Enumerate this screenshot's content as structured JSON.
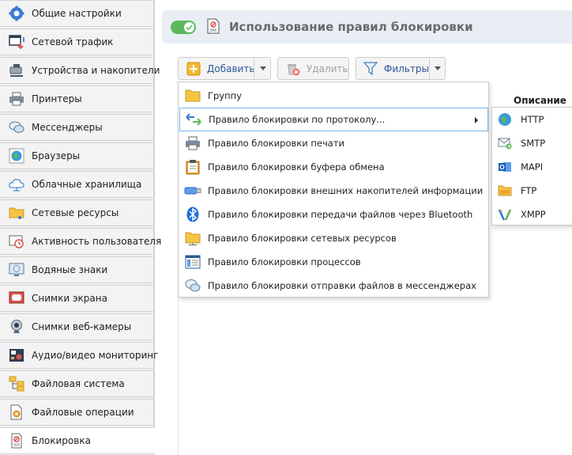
{
  "sidebar": {
    "items": [
      {
        "label": "Общие настройки",
        "icon": "gear-icon"
      },
      {
        "label": "Сетевой трафик",
        "icon": "network-traffic-icon"
      },
      {
        "label": "Устройства и накопители",
        "icon": "usb-device-icon"
      },
      {
        "label": "Принтеры",
        "icon": "printer-icon"
      },
      {
        "label": "Мессенджеры",
        "icon": "chat-icon"
      },
      {
        "label": "Браузеры",
        "icon": "browser-globe-icon"
      },
      {
        "label": "Облачные хранилища",
        "icon": "cloud-icon"
      },
      {
        "label": "Сетевые ресурсы",
        "icon": "network-folder-icon"
      },
      {
        "label": "Активность пользователя",
        "icon": "activity-clock-icon"
      },
      {
        "label": "Водяные знаки",
        "icon": "watermark-monitor-icon"
      },
      {
        "label": "Снимки экрана",
        "icon": "screenshot-icon"
      },
      {
        "label": "Снимки веб-камеры",
        "icon": "webcam-icon"
      },
      {
        "label": "Аудио/видео мониторинг",
        "icon": "av-monitoring-icon"
      },
      {
        "label": "Файловая система",
        "icon": "file-system-icon"
      },
      {
        "label": "Файловые операции",
        "icon": "file-operations-icon"
      },
      {
        "label": "Блокировка",
        "icon": "block-document-icon"
      }
    ],
    "active_index": 15
  },
  "header": {
    "title": "Использование правил блокировки",
    "toggle_on": true
  },
  "toolbar": {
    "add_label": "Добавить",
    "delete_label": "Удалить",
    "filters_label": "Фильтры"
  },
  "table": {
    "column_description": "Описание"
  },
  "add_menu": {
    "items": [
      {
        "label": "Группу",
        "icon": "folder-icon"
      },
      {
        "label": "Правило блокировки по протоколу...",
        "icon": "protocol-arrows-icon",
        "has_submenu": true
      },
      {
        "label": "Правило блокировки печати",
        "icon": "printer-icon"
      },
      {
        "label": "Правило блокировки буфера обмена",
        "icon": "clipboard-icon"
      },
      {
        "label": "Правило блокировки внешних накопителей информации",
        "icon": "usb-drive-icon"
      },
      {
        "label": "Правило блокировки передачи файлов через Bluetooth",
        "icon": "bluetooth-icon"
      },
      {
        "label": "Правило блокировки сетевых ресурсов",
        "icon": "network-folder-icon"
      },
      {
        "label": "Правило блокировки процессов",
        "icon": "process-window-icon"
      },
      {
        "label": "Правило блокировки отправки файлов в мессенджерах",
        "icon": "chat-icon"
      }
    ]
  },
  "protocol_submenu": {
    "items": [
      {
        "label": "HTTP",
        "icon": "http-globe-icon"
      },
      {
        "label": "SMTP",
        "icon": "smtp-mail-icon"
      },
      {
        "label": "MAPI",
        "icon": "mapi-outlook-icon"
      },
      {
        "label": "FTP",
        "icon": "ftp-folder-icon"
      },
      {
        "label": "XMPP",
        "icon": "xmpp-icon"
      }
    ]
  },
  "colors": {
    "toggle": "#5cb85c",
    "link": "#2b5797",
    "header_bg": "#e8eef4",
    "highlight_border": "#7eb4ea"
  }
}
